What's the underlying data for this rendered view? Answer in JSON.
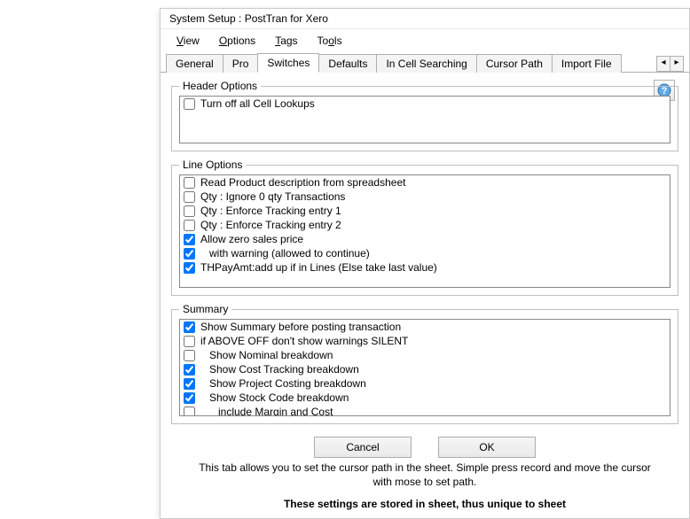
{
  "window": {
    "title": "System Setup : PostTran for Xero"
  },
  "menu": {
    "view": {
      "label": "View",
      "ul": "V"
    },
    "options": {
      "label": "Options",
      "ul": "O"
    },
    "tags": {
      "label": "Tags",
      "ul": "T"
    },
    "tools": {
      "label": "Tools",
      "ul": "o"
    }
  },
  "tabs": [
    {
      "label": "General",
      "active": false
    },
    {
      "label": "Pro",
      "active": false
    },
    {
      "label": "Switches",
      "active": true
    },
    {
      "label": "Defaults",
      "active": false
    },
    {
      "label": "In Cell Searching",
      "active": false
    },
    {
      "label": "Cursor Path",
      "active": false
    },
    {
      "label": "Import File",
      "active": false
    }
  ],
  "tabnav": {
    "left": "◂",
    "right": "▸"
  },
  "groups": {
    "header": {
      "legend": "Header Options"
    },
    "line": {
      "legend": "Line Options"
    },
    "summary": {
      "legend": "Summary"
    }
  },
  "headerOptions": [
    {
      "label": "Turn off all Cell Lookups",
      "checked": false
    }
  ],
  "lineOptions": [
    {
      "label": "Read Product description from spreadsheet",
      "checked": false
    },
    {
      "label": "Qty : Ignore 0 qty Transactions",
      "checked": false
    },
    {
      "label": "Qty : Enforce Tracking entry 1",
      "checked": false
    },
    {
      "label": "Qty : Enforce Tracking entry 2",
      "checked": false
    },
    {
      "label": "Allow zero sales price",
      "checked": true
    },
    {
      "label": "   with warning (allowed to continue)",
      "checked": true
    },
    {
      "label": "THPayAmt:add up if in Lines (Else take last value)",
      "checked": true
    }
  ],
  "summaryOptions": [
    {
      "label": "Show Summary before posting transaction",
      "checked": true
    },
    {
      "label": "if ABOVE OFF don't show warnings SILENT",
      "checked": false
    },
    {
      "label": "   Show Nominal breakdown",
      "checked": false
    },
    {
      "label": "   Show Cost Tracking breakdown",
      "checked": true
    },
    {
      "label": "   Show Project Costing breakdown",
      "checked": true
    },
    {
      "label": "   Show Stock Code breakdown",
      "checked": true
    },
    {
      "label": "      include Margin and Cost",
      "checked": false
    }
  ],
  "buttons": {
    "cancel": "Cancel",
    "ok": "OK"
  },
  "footer": {
    "note": "This tab allows you to set the cursor path in the sheet.  Simple press record and move the cursor with mose to set path.",
    "bold": "These settings are stored in sheet, thus unique to sheet"
  }
}
